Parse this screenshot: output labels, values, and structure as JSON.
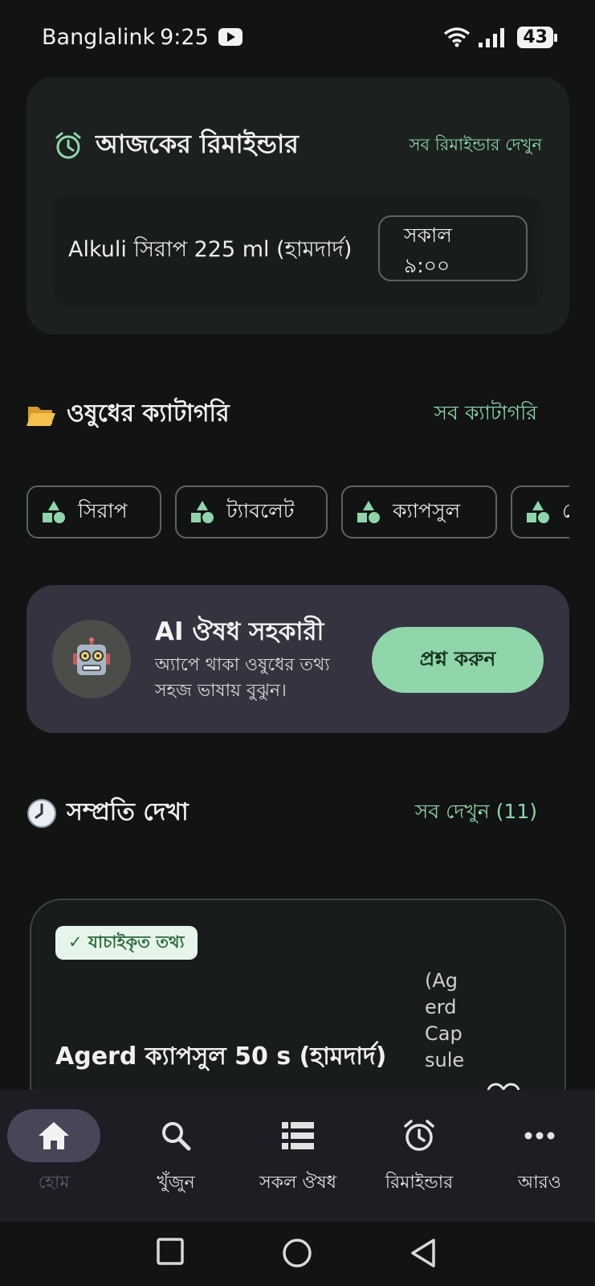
{
  "status_bar": {
    "carrier": "Banglalink",
    "time": "9:25",
    "battery": "43"
  },
  "reminder": {
    "title": "আজকের রিমাইন্ডার",
    "see_all": "সব রিমাইন্ডার দেখুন",
    "item": {
      "medicine": "Alkuli সিরাপ 225 ml (হামদার্দ)",
      "time_line1": "সকাল",
      "time_line2": "৯:০০"
    }
  },
  "categories": {
    "title": "ওষুধের ক্যাটাগরি",
    "see_all": "সব ক্যাটাগরি",
    "chips": [
      {
        "label": "সিরাপ"
      },
      {
        "label": "ট্যাবলেট"
      },
      {
        "label": "ক্যাপসুল"
      },
      {
        "label": "ে"
      }
    ]
  },
  "ai_assistant": {
    "title": "AI ঔষধ সহকারী",
    "description": "অ্যাপে থাকা ওষুধের তথ্য সহজ ভাষায় বুঝুন।",
    "button": "প্রশ্ন করুন"
  },
  "recent": {
    "title": "সম্প্রতি দেখা",
    "see_all": "সব দেখুন (11)",
    "card": {
      "badge": "✓ যাচাইকৃত তথ্য",
      "name": "Agerd ক্যাপসুল 50 s (হামদার্দ)",
      "alt_name": "(Agerd Capsule"
    }
  },
  "bottom_nav": {
    "items": [
      {
        "label": "হোম",
        "icon": "home-icon",
        "active": true
      },
      {
        "label": "খুঁজুন",
        "icon": "search-icon"
      },
      {
        "label": "সকল ঔষধ",
        "icon": "list-icon"
      },
      {
        "label": "রিমাইন্ডার",
        "icon": "alarm-icon"
      },
      {
        "label": "আরও",
        "icon": "more-icon"
      }
    ]
  },
  "colors": {
    "accent": "#8fd6aa",
    "background": "#111413",
    "card": "#1c211f",
    "ai_card": "#353340"
  }
}
